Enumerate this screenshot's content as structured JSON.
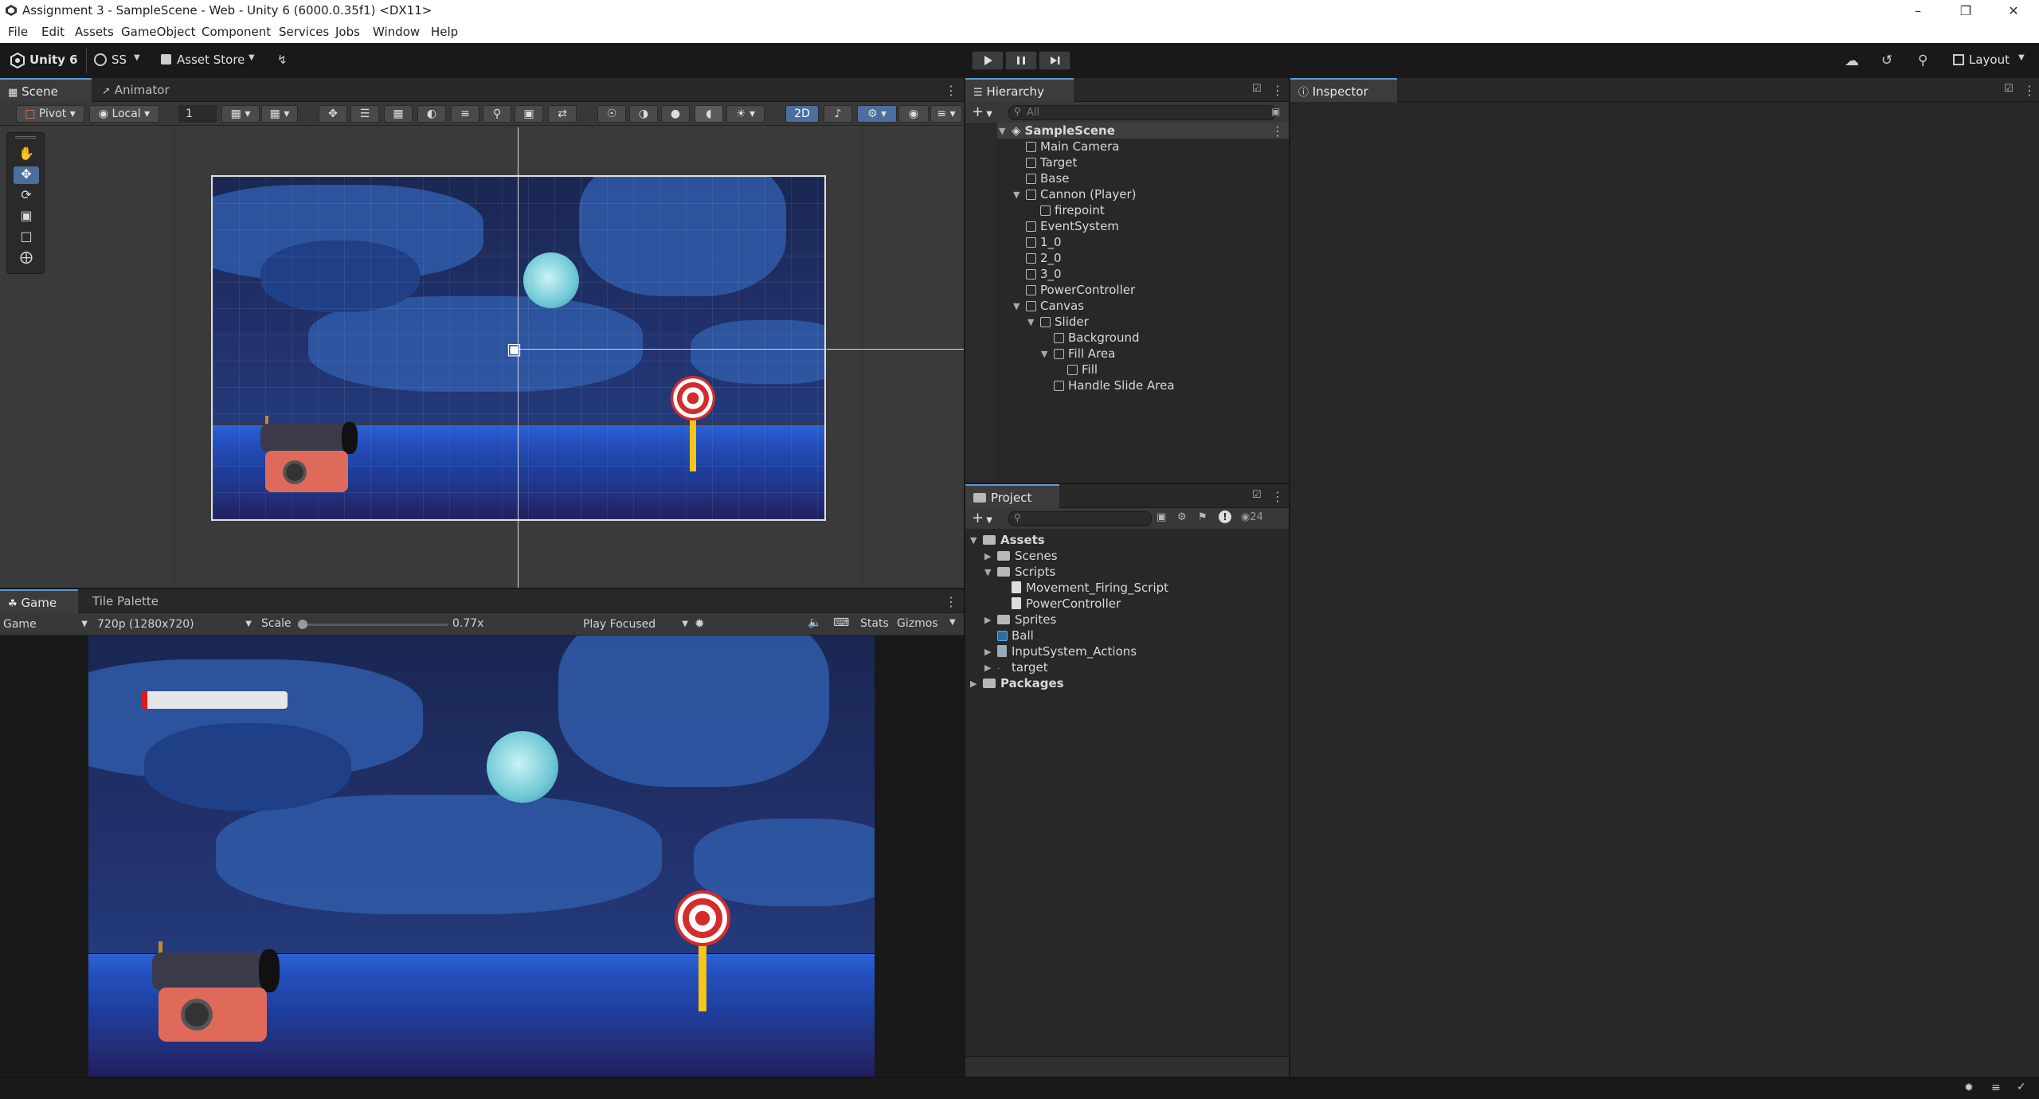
{
  "window": {
    "title": "Assignment 3 - SampleScene - Web - Unity 6 (6000.0.35f1) <DX11>"
  },
  "menu": [
    "File",
    "Edit",
    "Assets",
    "GameObject",
    "Component",
    "Services",
    "Jobs",
    "Window",
    "Help"
  ],
  "toolbar": {
    "unity_label": "Unity 6",
    "account_label": "SS",
    "asset_store_label": "Asset Store",
    "layout_label": "Layout"
  },
  "scene_panel": {
    "tabs": [
      "Scene",
      "Animator"
    ],
    "pivot_label": "Pivot",
    "local_label": "Local",
    "snap_value": "1",
    "mode_2d_label": "2D"
  },
  "game_panel": {
    "tabs": [
      "Game",
      "Tile Palette"
    ],
    "display_label": "Game",
    "resolution_label": "720p (1280x720)",
    "scale_label": "Scale",
    "scale_value": "0.77x",
    "play_mode_label": "Play Focused",
    "stats_label": "Stats",
    "gizmos_label": "Gizmos",
    "power_slider_fill": 0.03
  },
  "hierarchy": {
    "tab": "Hierarchy",
    "search_placeholder": "All",
    "items": [
      {
        "label": "SampleScene",
        "depth": 0
      },
      {
        "label": "Main Camera",
        "depth": 1
      },
      {
        "label": "Target",
        "depth": 1
      },
      {
        "label": "Base",
        "depth": 1
      },
      {
        "label": "Cannon (Player)",
        "depth": 1
      },
      {
        "label": "firepoint",
        "depth": 2
      },
      {
        "label": "EventSystem",
        "depth": 1
      },
      {
        "label": "1_0",
        "depth": 1
      },
      {
        "label": "2_0",
        "depth": 1
      },
      {
        "label": "3_0",
        "depth": 1
      },
      {
        "label": "PowerController",
        "depth": 1
      },
      {
        "label": "Canvas",
        "depth": 1
      },
      {
        "label": "Slider",
        "depth": 2
      },
      {
        "label": "Background",
        "depth": 3
      },
      {
        "label": "Fill Area",
        "depth": 3
      },
      {
        "label": "Fill",
        "depth": 4
      },
      {
        "label": "Handle Slide Area",
        "depth": 3
      }
    ]
  },
  "project": {
    "tab": "Project",
    "hidden_count": "24",
    "items": [
      {
        "label": "Assets",
        "depth": 0,
        "kind": "folder"
      },
      {
        "label": "Scenes",
        "depth": 1,
        "kind": "folder"
      },
      {
        "label": "Scripts",
        "depth": 1,
        "kind": "folder"
      },
      {
        "label": "Movement_Firing_Script",
        "depth": 2,
        "kind": "script"
      },
      {
        "label": "PowerController",
        "depth": 2,
        "kind": "script"
      },
      {
        "label": "Sprites",
        "depth": 1,
        "kind": "folder"
      },
      {
        "label": "Ball",
        "depth": 1,
        "kind": "prefab"
      },
      {
        "label": "InputSystem_Actions",
        "depth": 1,
        "kind": "asset"
      },
      {
        "label": "target",
        "depth": 1,
        "kind": "asset"
      },
      {
        "label": "Packages",
        "depth": 0,
        "kind": "folder"
      }
    ]
  },
  "inspector": {
    "tab": "Inspector"
  }
}
